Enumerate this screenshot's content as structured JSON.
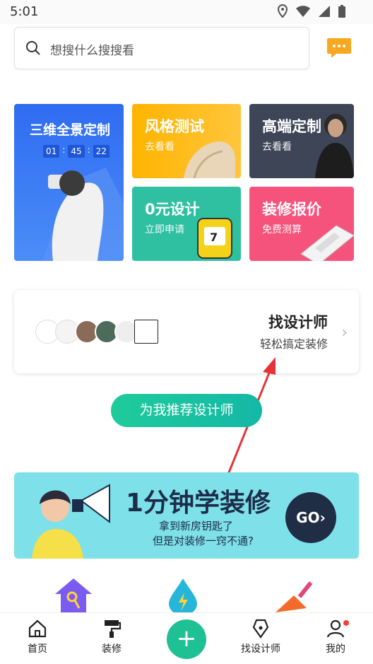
{
  "status": {
    "time": "5:01"
  },
  "search": {
    "placeholder": "想搜什么搜搜看"
  },
  "tiles": {
    "panorama": {
      "title": "三维全景定制",
      "timer": [
        "01",
        "45",
        "22"
      ]
    },
    "style": {
      "title": "风格测试",
      "sub": "去看看"
    },
    "highend": {
      "title": "高端定制",
      "sub": "去看看"
    },
    "zero": {
      "title": "0元设计",
      "sub": "立即申请"
    },
    "quote": {
      "title": "装修报价",
      "sub": "免费测算"
    }
  },
  "designer_card": {
    "title": "找设计师",
    "sub": "轻松搞定装修"
  },
  "recommend_button": "为我推荐设计师",
  "banner": {
    "title": "1分钟学装修",
    "line1": "拿到新房钥匙了",
    "line2": "但是对装修一窍不通?",
    "go": "GO"
  },
  "tabbar": {
    "home": "首页",
    "decor": "装修",
    "designer": "找设计师",
    "mine": "我的"
  },
  "colors": {
    "accent": "#1fc194",
    "blue": "#2f6cf1",
    "yellow": "#ffb400",
    "dark": "#3d4556",
    "green": "#2fc0a2",
    "pink": "#f5537c"
  }
}
